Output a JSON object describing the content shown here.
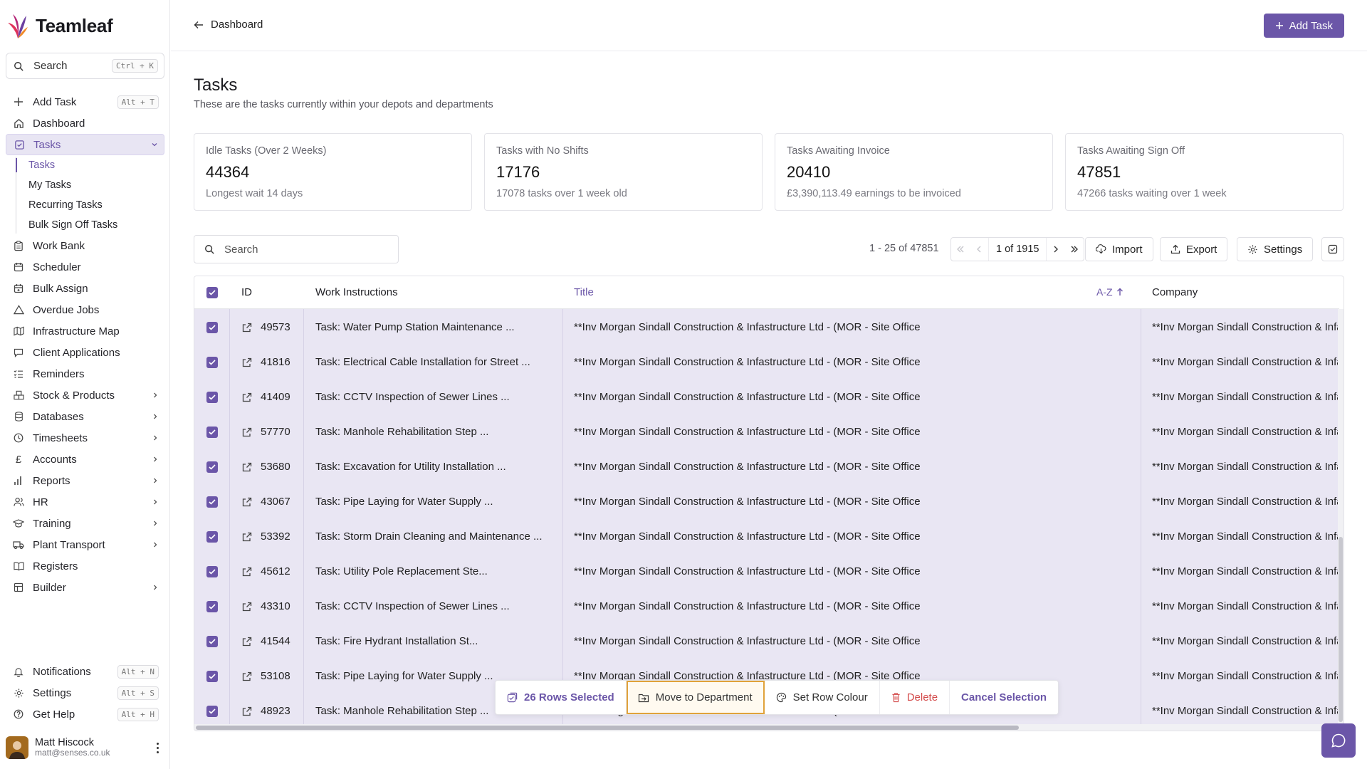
{
  "brand": {
    "name": "Teamleaf"
  },
  "sidebar": {
    "search": {
      "label": "Search",
      "shortcut": "Ctrl + K"
    },
    "items": [
      {
        "label": "Add Task",
        "icon": "plus-icon",
        "shortcut": "Alt + T"
      },
      {
        "label": "Dashboard",
        "icon": "home-icon"
      },
      {
        "label": "Tasks",
        "icon": "checkbox-icon",
        "expanded": true
      },
      {
        "label": "Work Bank",
        "icon": "clipboard-icon"
      },
      {
        "label": "Scheduler",
        "icon": "calendar-icon"
      },
      {
        "label": "Bulk Assign",
        "icon": "calendar-plus-icon"
      },
      {
        "label": "Overdue Jobs",
        "icon": "warning-icon"
      },
      {
        "label": "Infrastructure Map",
        "icon": "map-icon"
      },
      {
        "label": "Client Applications",
        "icon": "message-icon"
      },
      {
        "label": "Reminders",
        "icon": "list-check-icon"
      },
      {
        "label": "Stock & Products",
        "icon": "boxes-icon"
      },
      {
        "label": "Databases",
        "icon": "database-icon"
      },
      {
        "label": "Timesheets",
        "icon": "clock-icon"
      },
      {
        "label": "Accounts",
        "icon": "pound-icon"
      },
      {
        "label": "Reports",
        "icon": "bar-chart-icon"
      },
      {
        "label": "HR",
        "icon": "users-icon"
      },
      {
        "label": "Training",
        "icon": "graduation-cap-icon"
      },
      {
        "label": "Plant Transport",
        "icon": "truck-icon"
      },
      {
        "label": "Registers",
        "icon": "book-icon"
      },
      {
        "label": "Builder",
        "icon": "layout-icon"
      }
    ],
    "tasks_sub": [
      "Tasks",
      "My Tasks",
      "Recurring Tasks",
      "Bulk Sign Off Tasks"
    ],
    "bottom": [
      {
        "label": "Notifications",
        "icon": "bell-icon",
        "shortcut": "Alt + N"
      },
      {
        "label": "Settings",
        "icon": "gear-icon",
        "shortcut": "Alt + S"
      },
      {
        "label": "Get Help",
        "icon": "help-icon",
        "shortcut": "Alt + H"
      }
    ],
    "user": {
      "name": "Matt Hiscock",
      "email": "matt@senses.co.uk"
    }
  },
  "topbar": {
    "back_label": "Dashboard",
    "add_task_label": "Add Task"
  },
  "page": {
    "title": "Tasks",
    "subtitle": "These are the tasks currently within your depots and departments"
  },
  "stats": [
    {
      "title": "Idle Tasks (Over 2 Weeks)",
      "value": "44364",
      "sub": "Longest wait 14 days"
    },
    {
      "title": "Tasks with No Shifts",
      "value": "17176",
      "sub": "17078 tasks over 1 week old"
    },
    {
      "title": "Tasks Awaiting Invoice",
      "value": "20410",
      "sub": "£3,390,113.49 earnings to be invoiced"
    },
    {
      "title": "Tasks Awaiting Sign Off",
      "value": "47851",
      "sub": "47266 tasks waiting over 1 week"
    }
  ],
  "toolbar": {
    "search_placeholder": "Search",
    "range": "1 - 25 of 47851",
    "page": "1 of 1915",
    "import_label": "Import",
    "export_label": "Export",
    "settings_label": "Settings"
  },
  "table": {
    "columns": {
      "id": "ID",
      "work": "Work Instructions",
      "title": "Title",
      "sort": "A-Z",
      "company": "Company"
    },
    "rows": [
      {
        "id": "49573",
        "work": "Task: Water Pump Station Maintenance ...",
        "title": "**Inv Morgan Sindall Construction & Infastructure Ltd - (MOR - Site Office",
        "company": "**Inv Morgan Sindall Construction & Infa"
      },
      {
        "id": "41816",
        "work": "Task: Electrical Cable Installation for Street ...",
        "title": "**Inv Morgan Sindall Construction & Infastructure Ltd - (MOR - Site Office",
        "company": "**Inv Morgan Sindall Construction & Infa"
      },
      {
        "id": "41409",
        "work": "Task: CCTV Inspection of Sewer Lines ...",
        "title": "**Inv Morgan Sindall Construction & Infastructure Ltd - (MOR - Site Office",
        "company": "**Inv Morgan Sindall Construction & Infa"
      },
      {
        "id": "57770",
        "work": "Task: Manhole Rehabilitation Step ...",
        "title": "**Inv Morgan Sindall Construction & Infastructure Ltd - (MOR - Site Office",
        "company": "**Inv Morgan Sindall Construction & Infa"
      },
      {
        "id": "53680",
        "work": "Task: Excavation for Utility Installation ...",
        "title": "**Inv Morgan Sindall Construction & Infastructure Ltd - (MOR - Site Office",
        "company": "**Inv Morgan Sindall Construction & Infa"
      },
      {
        "id": "43067",
        "work": "Task: Pipe Laying for Water Supply ...",
        "title": "**Inv Morgan Sindall Construction & Infastructure Ltd - (MOR - Site Office",
        "company": "**Inv Morgan Sindall Construction & Infa"
      },
      {
        "id": "53392",
        "work": "Task: Storm Drain Cleaning and Maintenance ...",
        "title": "**Inv Morgan Sindall Construction & Infastructure Ltd - (MOR - Site Office",
        "company": "**Inv Morgan Sindall Construction & Infa"
      },
      {
        "id": "45612",
        "work": "Task: Utility Pole Replacement Ste...",
        "title": "**Inv Morgan Sindall Construction & Infastructure Ltd - (MOR - Site Office",
        "company": "**Inv Morgan Sindall Construction & Infa"
      },
      {
        "id": "43310",
        "work": "Task: CCTV Inspection of Sewer Lines ...",
        "title": "**Inv Morgan Sindall Construction & Infastructure Ltd - (MOR - Site Office",
        "company": "**Inv Morgan Sindall Construction & Infa"
      },
      {
        "id": "41544",
        "work": "Task: Fire Hydrant Installation St...",
        "title": "**Inv Morgan Sindall Construction & Infastructure Ltd - (MOR - Site Office",
        "company": "**Inv Morgan Sindall Construction & Infa"
      },
      {
        "id": "53108",
        "work": "Task: Pipe Laying for Water Supply ...",
        "title": "**Inv Morgan Sindall Construction & Infastructure Ltd - (MOR - Site Office",
        "company": "**Inv Morgan Sindall Construction & Infa"
      },
      {
        "id": "48923",
        "work": "Task: Manhole Rehabilitation Step ...",
        "title": "**Inv Morgan Sindall Construction & Infastructure Ltd - (MOR - Site Office",
        "company": "**Inv Morgan Sindall Construction & Infa"
      }
    ]
  },
  "selection_bar": {
    "count_label": "26 Rows Selected",
    "move_label": "Move to Department",
    "colour_label": "Set Row Colour",
    "delete_label": "Delete",
    "cancel_label": "Cancel Selection"
  },
  "colors": {
    "accent": "#6b56a8",
    "row_selected": "#e9e6f3",
    "danger": "#d34a4a",
    "focus": "#e0a23a"
  }
}
